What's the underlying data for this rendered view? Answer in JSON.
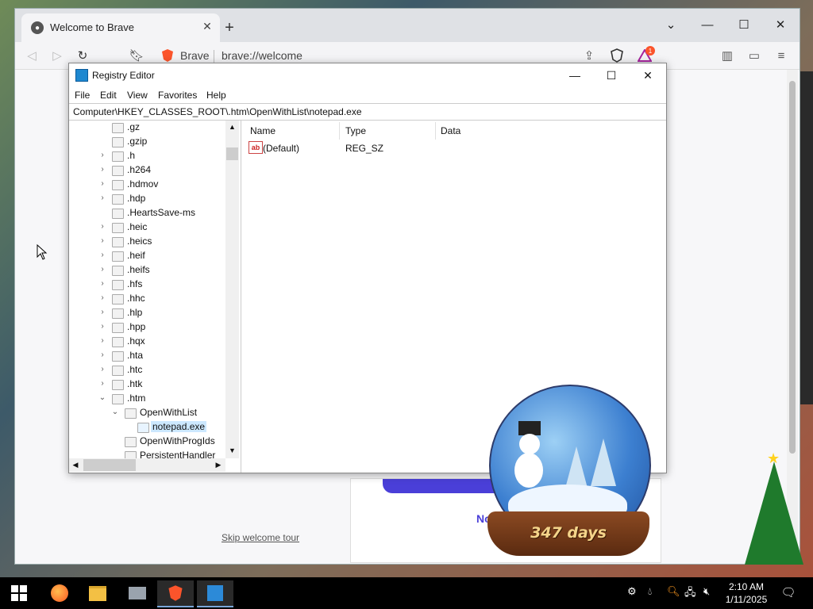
{
  "browser": {
    "tab_title": "Welcome to Brave",
    "shield_label": "Brave",
    "url": "brave://welcome",
    "notification_count": "1",
    "skip_link": "Skip welcome tour",
    "card_text": "No th"
  },
  "regedit": {
    "title": "Registry Editor",
    "menu": [
      "File",
      "Edit",
      "View",
      "Favorites",
      "Help"
    ],
    "address": "Computer\\HKEY_CLASSES_ROOT\\.htm\\OpenWithList\\notepad.exe",
    "tree": [
      {
        "label": ".gz",
        "arrow": ""
      },
      {
        "label": ".gzip",
        "arrow": ""
      },
      {
        "label": ".h",
        "arrow": ">"
      },
      {
        "label": ".h264",
        "arrow": ">"
      },
      {
        "label": ".hdmov",
        "arrow": ">"
      },
      {
        "label": ".hdp",
        "arrow": ">"
      },
      {
        "label": ".HeartsSave-ms",
        "arrow": ""
      },
      {
        "label": ".heic",
        "arrow": ">"
      },
      {
        "label": ".heics",
        "arrow": ">"
      },
      {
        "label": ".heif",
        "arrow": ">"
      },
      {
        "label": ".heifs",
        "arrow": ">"
      },
      {
        "label": ".hfs",
        "arrow": ">"
      },
      {
        "label": ".hhc",
        "arrow": ">"
      },
      {
        "label": ".hlp",
        "arrow": ">"
      },
      {
        "label": ".hpp",
        "arrow": ">"
      },
      {
        "label": ".hqx",
        "arrow": ">"
      },
      {
        "label": ".hta",
        "arrow": ">"
      },
      {
        "label": ".htc",
        "arrow": ">"
      },
      {
        "label": ".htk",
        "arrow": ">"
      },
      {
        "label": ".htm",
        "arrow": "v"
      },
      {
        "label": "OpenWithList",
        "arrow": "v"
      },
      {
        "label": "notepad.exe",
        "arrow": ""
      },
      {
        "label": "OpenWithProgIds",
        "arrow": ""
      },
      {
        "label": "PersistentHandler",
        "arrow": ""
      }
    ],
    "columns": {
      "name": "Name",
      "type": "Type",
      "data": "Data"
    },
    "values": [
      {
        "icon": "ab",
        "name": "(Default)",
        "type": "REG_SZ",
        "data": ""
      }
    ]
  },
  "widget": {
    "days": "347 days"
  },
  "taskbar": {
    "time": "2:10 AM",
    "date": "1/11/2025"
  },
  "colors": {
    "accent": "#4a3fd8",
    "selection": "#cce8ff",
    "brave_orange": "#fb542b"
  }
}
